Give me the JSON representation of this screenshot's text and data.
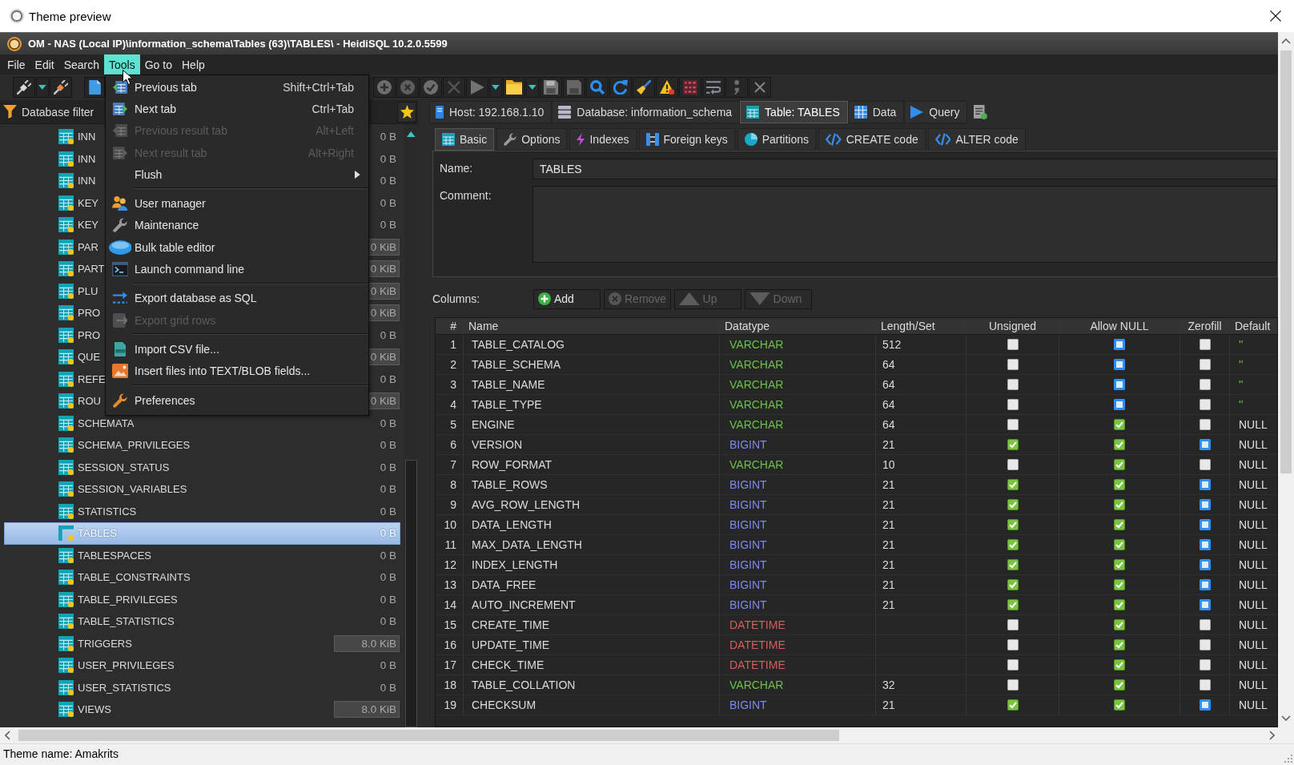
{
  "window": {
    "title": "Theme preview"
  },
  "app": {
    "title": "OM - NAS (Local IP)\\information_schema\\Tables (63)\\TABLES\\ - HeidiSQL 10.2.0.5599"
  },
  "menu_bar": [
    {
      "label": "File",
      "selected": false
    },
    {
      "label": "Edit",
      "selected": false
    },
    {
      "label": "Search",
      "selected": false
    },
    {
      "label": "Tools",
      "selected": true
    },
    {
      "label": "Go to",
      "selected": false
    },
    {
      "label": "Help",
      "selected": false
    }
  ],
  "tools_menu": {
    "items": [
      {
        "kind": "item",
        "label": "Previous tab",
        "shortcut": "Shift+Ctrl+Tab",
        "disabled": false,
        "submenu": false
      },
      {
        "kind": "item",
        "label": "Next tab",
        "shortcut": "Ctrl+Tab",
        "disabled": false,
        "submenu": false
      },
      {
        "kind": "item",
        "label": "Previous result tab",
        "shortcut": "Alt+Left",
        "disabled": true,
        "submenu": false
      },
      {
        "kind": "item",
        "label": "Next result tab",
        "shortcut": "Alt+Right",
        "disabled": true,
        "submenu": false
      },
      {
        "kind": "item",
        "label": "Flush",
        "disabled": false,
        "submenu": true
      },
      {
        "kind": "separator"
      },
      {
        "kind": "item",
        "label": "User manager",
        "disabled": false,
        "submenu": false
      },
      {
        "kind": "item",
        "label": "Maintenance",
        "disabled": false,
        "submenu": false
      },
      {
        "kind": "item",
        "label": "Bulk table editor",
        "disabled": false,
        "submenu": false
      },
      {
        "kind": "item",
        "label": "Launch command line",
        "disabled": false,
        "submenu": false
      },
      {
        "kind": "separator"
      },
      {
        "kind": "item",
        "label": "Export database as SQL",
        "disabled": false,
        "submenu": false
      },
      {
        "kind": "item",
        "label": "Export grid rows",
        "disabled": true,
        "submenu": false
      },
      {
        "kind": "separator"
      },
      {
        "kind": "item",
        "label": "Import CSV file...",
        "disabled": false,
        "submenu": false
      },
      {
        "kind": "item",
        "label": "Insert files into TEXT/BLOB fields...",
        "disabled": false,
        "submenu": false
      },
      {
        "kind": "separator"
      },
      {
        "kind": "item",
        "label": "Preferences",
        "disabled": false,
        "submenu": false
      }
    ]
  },
  "database_filter": {
    "label": "Database filter"
  },
  "tree": {
    "items": [
      {
        "name": "INN",
        "size": "0 B",
        "highlighted": false,
        "selected": false
      },
      {
        "name": "INN",
        "size": "0 B",
        "highlighted": false,
        "selected": false
      },
      {
        "name": "INN",
        "size": "0 B",
        "highlighted": false,
        "selected": false
      },
      {
        "name": "KEY",
        "size": "0 B",
        "highlighted": false,
        "selected": false
      },
      {
        "name": "KEY",
        "size": "0 B",
        "highlighted": false,
        "selected": false
      },
      {
        "name": "PAR",
        "size": "0 KiB",
        "highlighted": true,
        "selected": false
      },
      {
        "name": "PART",
        "size": "0 KiB",
        "highlighted": true,
        "selected": false
      },
      {
        "name": "PLU",
        "size": "0 KiB",
        "highlighted": true,
        "selected": false
      },
      {
        "name": "PRO",
        "size": "0 KiB",
        "highlighted": true,
        "selected": false
      },
      {
        "name": "PRO",
        "size": "0 B",
        "highlighted": false,
        "selected": false
      },
      {
        "name": "QUE",
        "size": "0 KiB",
        "highlighted": true,
        "selected": false
      },
      {
        "name": "REFE",
        "size": "0 B",
        "highlighted": false,
        "selected": false
      },
      {
        "name": "ROU",
        "size": "0 KiB",
        "highlighted": true,
        "selected": false
      },
      {
        "name": "SCHEMATA",
        "size": "0 B",
        "highlighted": false,
        "selected": false
      },
      {
        "name": "SCHEMA_PRIVILEGES",
        "size": "0 B",
        "highlighted": false,
        "selected": false
      },
      {
        "name": "SESSION_STATUS",
        "size": "0 B",
        "highlighted": false,
        "selected": false
      },
      {
        "name": "SESSION_VARIABLES",
        "size": "0 B",
        "highlighted": false,
        "selected": false
      },
      {
        "name": "STATISTICS",
        "size": "0 B",
        "highlighted": false,
        "selected": false
      },
      {
        "name": "TABLES",
        "size": "0 B",
        "highlighted": false,
        "selected": true
      },
      {
        "name": "TABLESPACES",
        "size": "0 B",
        "highlighted": false,
        "selected": false
      },
      {
        "name": "TABLE_CONSTRAINTS",
        "size": "0 B",
        "highlighted": false,
        "selected": false
      },
      {
        "name": "TABLE_PRIVILEGES",
        "size": "0 B",
        "highlighted": false,
        "selected": false
      },
      {
        "name": "TABLE_STATISTICS",
        "size": "0 B",
        "highlighted": false,
        "selected": false
      },
      {
        "name": "TRIGGERS",
        "size": "8.0 KiB",
        "highlighted": true,
        "selected": false
      },
      {
        "name": "USER_PRIVILEGES",
        "size": "0 B",
        "highlighted": false,
        "selected": false
      },
      {
        "name": "USER_STATISTICS",
        "size": "0 B",
        "highlighted": false,
        "selected": false
      },
      {
        "name": "VIEWS",
        "size": "8.0 KiB",
        "highlighted": true,
        "selected": false
      }
    ]
  },
  "tabs": [
    {
      "label": "Host: 192.168.1.10",
      "selected": false
    },
    {
      "label": "Database: information_schema",
      "selected": false
    },
    {
      "label": "Table: TABLES",
      "selected": true
    },
    {
      "label": "Data",
      "selected": false
    },
    {
      "label": "Query",
      "selected": false
    }
  ],
  "editor_tabs": [
    {
      "label": "Basic",
      "selected": true
    },
    {
      "label": "Options",
      "selected": false
    },
    {
      "label": "Indexes",
      "selected": false
    },
    {
      "label": "Foreign keys",
      "selected": false
    },
    {
      "label": "Partitions",
      "selected": false
    },
    {
      "label": "CREATE code",
      "selected": false
    },
    {
      "label": "ALTER code",
      "selected": false
    }
  ],
  "form": {
    "name": {
      "label": "Name:",
      "value": "TABLES"
    },
    "comment": {
      "label": "Comment:"
    }
  },
  "columns_toolbar": {
    "label": "Columns:",
    "buttons": [
      {
        "label": "Add",
        "disabled": false
      },
      {
        "label": "Remove",
        "disabled": true
      },
      {
        "label": "Up",
        "disabled": true
      },
      {
        "label": "Down",
        "disabled": true
      }
    ]
  },
  "table": {
    "columns": [
      "#",
      "Name",
      "Datatype",
      "Length/Set",
      "Unsigned",
      "Allow NULL",
      "Zerofill",
      "Default"
    ],
    "rows": [
      {
        "number": "1",
        "name": "TABLE_CATALOG",
        "datatype": {
          "text": "VARCHAR",
          "color": "#6cc04a"
        },
        "length": "512",
        "unsigned": {
          "checked": false,
          "disabled": true
        },
        "allow_null": {
          "checked": false,
          "disabled": false
        },
        "zerofill": {
          "checked": false,
          "disabled": true
        },
        "default": {
          "text": "''",
          "kind": "string"
        }
      },
      {
        "number": "2",
        "name": "TABLE_SCHEMA",
        "datatype": {
          "text": "VARCHAR",
          "color": "#6cc04a"
        },
        "length": "64",
        "unsigned": {
          "checked": false,
          "disabled": true
        },
        "allow_null": {
          "checked": false,
          "disabled": false
        },
        "zerofill": {
          "checked": false,
          "disabled": true
        },
        "default": {
          "text": "''",
          "kind": "string"
        }
      },
      {
        "number": "3",
        "name": "TABLE_NAME",
        "datatype": {
          "text": "VARCHAR",
          "color": "#6cc04a"
        },
        "length": "64",
        "unsigned": {
          "checked": false,
          "disabled": true
        },
        "allow_null": {
          "checked": false,
          "disabled": false
        },
        "zerofill": {
          "checked": false,
          "disabled": true
        },
        "default": {
          "text": "''",
          "kind": "string"
        }
      },
      {
        "number": "4",
        "name": "TABLE_TYPE",
        "datatype": {
          "text": "VARCHAR",
          "color": "#6cc04a"
        },
        "length": "64",
        "unsigned": {
          "checked": false,
          "disabled": true
        },
        "allow_null": {
          "checked": false,
          "disabled": false
        },
        "zerofill": {
          "checked": false,
          "disabled": true
        },
        "default": {
          "text": "''",
          "kind": "string"
        }
      },
      {
        "number": "5",
        "name": "ENGINE",
        "datatype": {
          "text": "VARCHAR",
          "color": "#6cc04a"
        },
        "length": "64",
        "unsigned": {
          "checked": false,
          "disabled": true
        },
        "allow_null": {
          "checked": true,
          "disabled": false
        },
        "zerofill": {
          "checked": false,
          "disabled": true
        },
        "default": {
          "text": "NULL",
          "kind": "null"
        }
      },
      {
        "number": "6",
        "name": "VERSION",
        "datatype": {
          "text": "BIGINT",
          "color": "#8088ee"
        },
        "length": "21",
        "unsigned": {
          "checked": true,
          "disabled": false
        },
        "allow_null": {
          "checked": true,
          "disabled": false
        },
        "zerofill": {
          "checked": false,
          "disabled": false
        },
        "default": {
          "text": "NULL",
          "kind": "null"
        }
      },
      {
        "number": "7",
        "name": "ROW_FORMAT",
        "datatype": {
          "text": "VARCHAR",
          "color": "#6cc04a"
        },
        "length": "10",
        "unsigned": {
          "checked": false,
          "disabled": true
        },
        "allow_null": {
          "checked": true,
          "disabled": false
        },
        "zerofill": {
          "checked": false,
          "disabled": true
        },
        "default": {
          "text": "NULL",
          "kind": "null"
        }
      },
      {
        "number": "8",
        "name": "TABLE_ROWS",
        "datatype": {
          "text": "BIGINT",
          "color": "#8088ee"
        },
        "length": "21",
        "unsigned": {
          "checked": true,
          "disabled": false
        },
        "allow_null": {
          "checked": true,
          "disabled": false
        },
        "zerofill": {
          "checked": false,
          "disabled": false
        },
        "default": {
          "text": "NULL",
          "kind": "null"
        }
      },
      {
        "number": "9",
        "name": "AVG_ROW_LENGTH",
        "datatype": {
          "text": "BIGINT",
          "color": "#8088ee"
        },
        "length": "21",
        "unsigned": {
          "checked": true,
          "disabled": false
        },
        "allow_null": {
          "checked": true,
          "disabled": false
        },
        "zerofill": {
          "checked": false,
          "disabled": false
        },
        "default": {
          "text": "NULL",
          "kind": "null"
        }
      },
      {
        "number": "10",
        "name": "DATA_LENGTH",
        "datatype": {
          "text": "BIGINT",
          "color": "#8088ee"
        },
        "length": "21",
        "unsigned": {
          "checked": true,
          "disabled": false
        },
        "allow_null": {
          "checked": true,
          "disabled": false
        },
        "zerofill": {
          "checked": false,
          "disabled": false
        },
        "default": {
          "text": "NULL",
          "kind": "null"
        }
      },
      {
        "number": "11",
        "name": "MAX_DATA_LENGTH",
        "datatype": {
          "text": "BIGINT",
          "color": "#8088ee"
        },
        "length": "21",
        "unsigned": {
          "checked": true,
          "disabled": false
        },
        "allow_null": {
          "checked": true,
          "disabled": false
        },
        "zerofill": {
          "checked": false,
          "disabled": false
        },
        "default": {
          "text": "NULL",
          "kind": "null"
        }
      },
      {
        "number": "12",
        "name": "INDEX_LENGTH",
        "datatype": {
          "text": "BIGINT",
          "color": "#8088ee"
        },
        "length": "21",
        "unsigned": {
          "checked": true,
          "disabled": false
        },
        "allow_null": {
          "checked": true,
          "disabled": false
        },
        "zerofill": {
          "checked": false,
          "disabled": false
        },
        "default": {
          "text": "NULL",
          "kind": "null"
        }
      },
      {
        "number": "13",
        "name": "DATA_FREE",
        "datatype": {
          "text": "BIGINT",
          "color": "#8088ee"
        },
        "length": "21",
        "unsigned": {
          "checked": true,
          "disabled": false
        },
        "allow_null": {
          "checked": true,
          "disabled": false
        },
        "zerofill": {
          "checked": false,
          "disabled": false
        },
        "default": {
          "text": "NULL",
          "kind": "null"
        }
      },
      {
        "number": "14",
        "name": "AUTO_INCREMENT",
        "datatype": {
          "text": "BIGINT",
          "color": "#8088ee"
        },
        "length": "21",
        "unsigned": {
          "checked": true,
          "disabled": false
        },
        "allow_null": {
          "checked": true,
          "disabled": false
        },
        "zerofill": {
          "checked": false,
          "disabled": false
        },
        "default": {
          "text": "NULL",
          "kind": "null"
        }
      },
      {
        "number": "15",
        "name": "CREATE_TIME",
        "datatype": {
          "text": "DATETIME",
          "color": "#d0605e"
        },
        "unsigned": {
          "checked": false,
          "disabled": true
        },
        "allow_null": {
          "checked": true,
          "disabled": false
        },
        "zerofill": {
          "checked": false,
          "disabled": true
        },
        "default": {
          "text": "NULL",
          "kind": "null"
        }
      },
      {
        "number": "16",
        "name": "UPDATE_TIME",
        "datatype": {
          "text": "DATETIME",
          "color": "#d0605e"
        },
        "unsigned": {
          "checked": false,
          "disabled": true
        },
        "allow_null": {
          "checked": true,
          "disabled": false
        },
        "zerofill": {
          "checked": false,
          "disabled": true
        },
        "default": {
          "text": "NULL",
          "kind": "null"
        }
      },
      {
        "number": "17",
        "name": "CHECK_TIME",
        "datatype": {
          "text": "DATETIME",
          "color": "#d0605e"
        },
        "unsigned": {
          "checked": false,
          "disabled": true
        },
        "allow_null": {
          "checked": true,
          "disabled": false
        },
        "zerofill": {
          "checked": false,
          "disabled": true
        },
        "default": {
          "text": "NULL",
          "kind": "null"
        }
      },
      {
        "number": "18",
        "name": "TABLE_COLLATION",
        "datatype": {
          "text": "VARCHAR",
          "color": "#6cc04a"
        },
        "length": "32",
        "unsigned": {
          "checked": false,
          "disabled": true
        },
        "allow_null": {
          "checked": true,
          "disabled": false
        },
        "zerofill": {
          "checked": false,
          "disabled": true
        },
        "default": {
          "text": "NULL",
          "kind": "null"
        }
      },
      {
        "number": "19",
        "name": "CHECKSUM",
        "datatype": {
          "text": "BIGINT",
          "color": "#8088ee"
        },
        "length": "21",
        "unsigned": {
          "checked": true,
          "disabled": false
        },
        "allow_null": {
          "checked": true,
          "disabled": false
        },
        "zerofill": {
          "checked": false,
          "disabled": false
        },
        "default": {
          "text": "NULL",
          "kind": "null"
        }
      }
    ]
  },
  "status_bar": {
    "text": "Theme name: Amakrits"
  }
}
